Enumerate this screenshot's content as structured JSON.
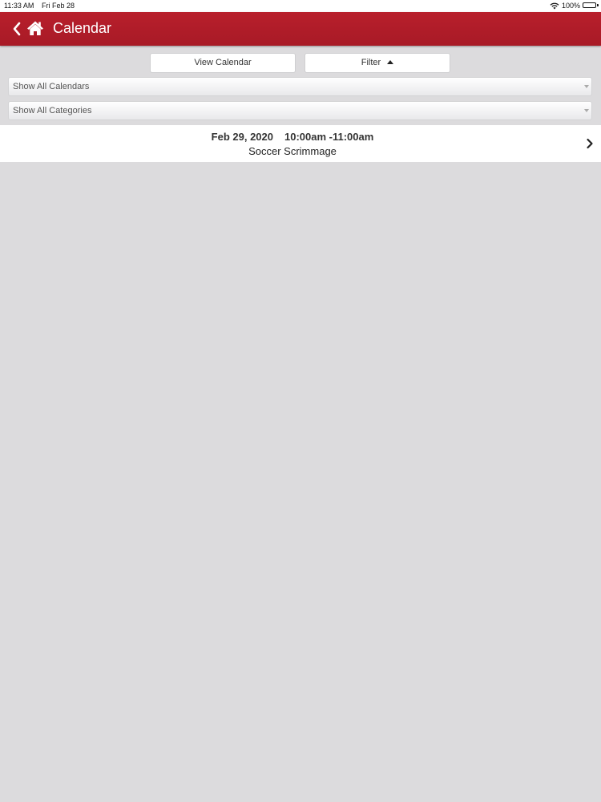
{
  "status_bar": {
    "time": "11:33 AM",
    "date": "Fri Feb 28",
    "battery": "100%",
    "icons": [
      "wifi-icon",
      "battery-icon"
    ]
  },
  "header": {
    "title": "Calendar",
    "icons": [
      "chevron-left-icon",
      "home-icon"
    ],
    "color": "#b31e2b"
  },
  "toolbar": {
    "view_calendar_label": "View Calendar",
    "filter_label": "Filter",
    "filter_icon": "caret-up-icon"
  },
  "filters": {
    "calendars_selected": "Show All Calendars",
    "categories_selected": "Show All Categories"
  },
  "events": [
    {
      "date": "Feb 29, 2020",
      "time": "10:00am -11:00am",
      "title": "Soccer Scrimmage",
      "icon": "chevron-right-icon"
    }
  ]
}
